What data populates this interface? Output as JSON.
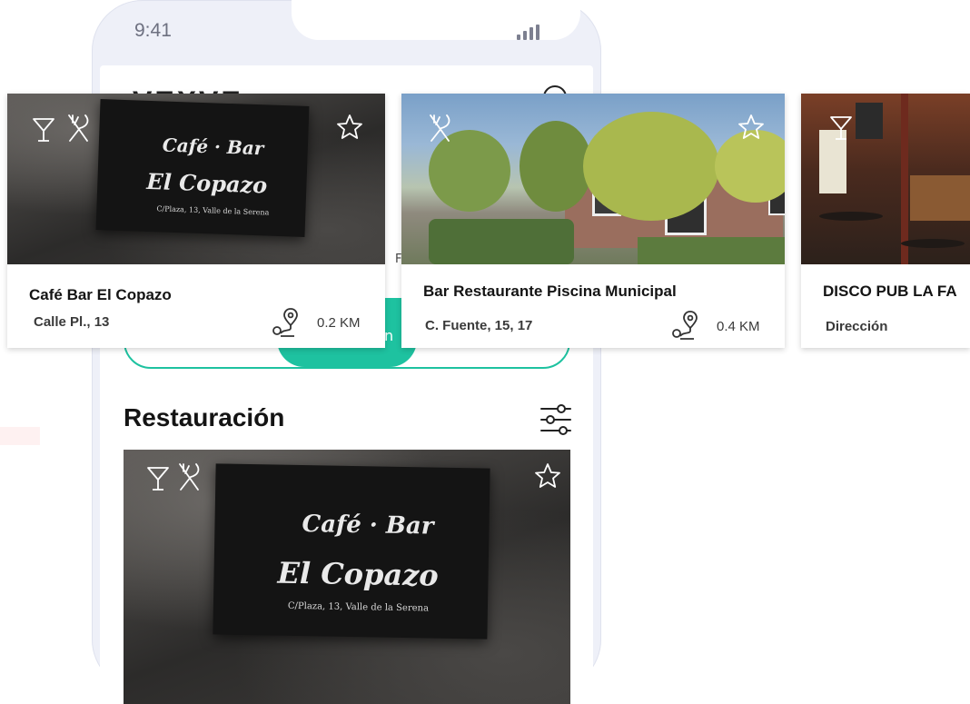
{
  "status_bar": {
    "time": "9:41"
  },
  "app": {
    "logo_text": "VEXVE"
  },
  "segmented_control": {
    "active_label": "n"
  },
  "peek_text": "F",
  "section": {
    "title": "Restauración"
  },
  "icons": {
    "cocktail": "cocktail-icon",
    "cutlery": "cutlery-icon",
    "favorite": "star-outline-icon",
    "route": "route-pin-icon",
    "filter": "sliders-icon"
  },
  "colors": {
    "accent": "#1ec2a0",
    "text": "#141414",
    "muted": "#3a3a3a"
  },
  "cards": [
    {
      "title": "Café Bar El Copazo",
      "address": "Calle Pl., 13",
      "distance": "0.2 KM"
    },
    {
      "title": "Bar Restaurante Piscina Municipal",
      "address": "C. Fuente, 15, 17",
      "distance": "0.4 KM"
    },
    {
      "title": "DISCO PUB LA FA",
      "address": "Dirección",
      "distance": ""
    }
  ],
  "business_card": {
    "line1": "Café · Bar",
    "line2": "El Copazo",
    "line3": "C/Plaza, 13, Valle de la Serena"
  }
}
